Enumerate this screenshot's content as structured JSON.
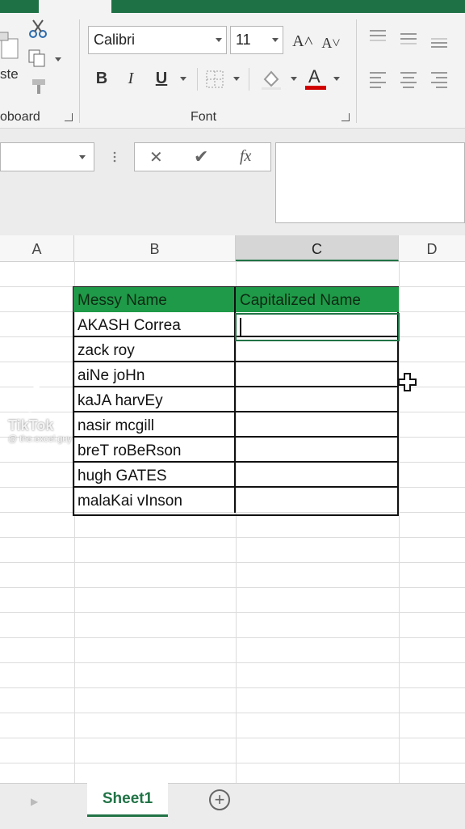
{
  "ribbon": {
    "clipboard": {
      "label": "oboard",
      "paste_label": "ste"
    },
    "font": {
      "label": "Font",
      "font_name": "Calibri",
      "font_size": "11",
      "grow_icon": "A˄",
      "shrink_icon": "A˅",
      "bold": "B",
      "italic": "I",
      "underline": "U",
      "font_color_icon": "A"
    }
  },
  "formula_bar": {
    "cancel": "✕",
    "enter": "✔",
    "fx": "fx",
    "value": ""
  },
  "columns": [
    {
      "name": "A",
      "selected": false
    },
    {
      "name": "B",
      "selected": false
    },
    {
      "name": "C",
      "selected": true
    },
    {
      "name": "D",
      "selected": false
    }
  ],
  "table": {
    "header": {
      "col_b": "Messy Name",
      "col_c": "Capitalized Name"
    },
    "rows": [
      {
        "b": "AKASH Correa",
        "c": ""
      },
      {
        "b": "zack roy",
        "c": ""
      },
      {
        "b": "aiNe joHn",
        "c": ""
      },
      {
        "b": "kaJA harvEy",
        "c": ""
      },
      {
        "b": "nasir mcgill",
        "c": ""
      },
      {
        "b": "breT roBeRson",
        "c": ""
      },
      {
        "b": "hugh GATES",
        "c": ""
      },
      {
        "b": "malaKai vInson",
        "c": ""
      }
    ]
  },
  "sheets": {
    "active": "Sheet1"
  },
  "watermark": {
    "brand": "TikTok",
    "handle": "@ the.excel.guy"
  },
  "colors": {
    "excel_green": "#217346",
    "header_fill": "#1f9a48",
    "font_red": "#d00000"
  }
}
